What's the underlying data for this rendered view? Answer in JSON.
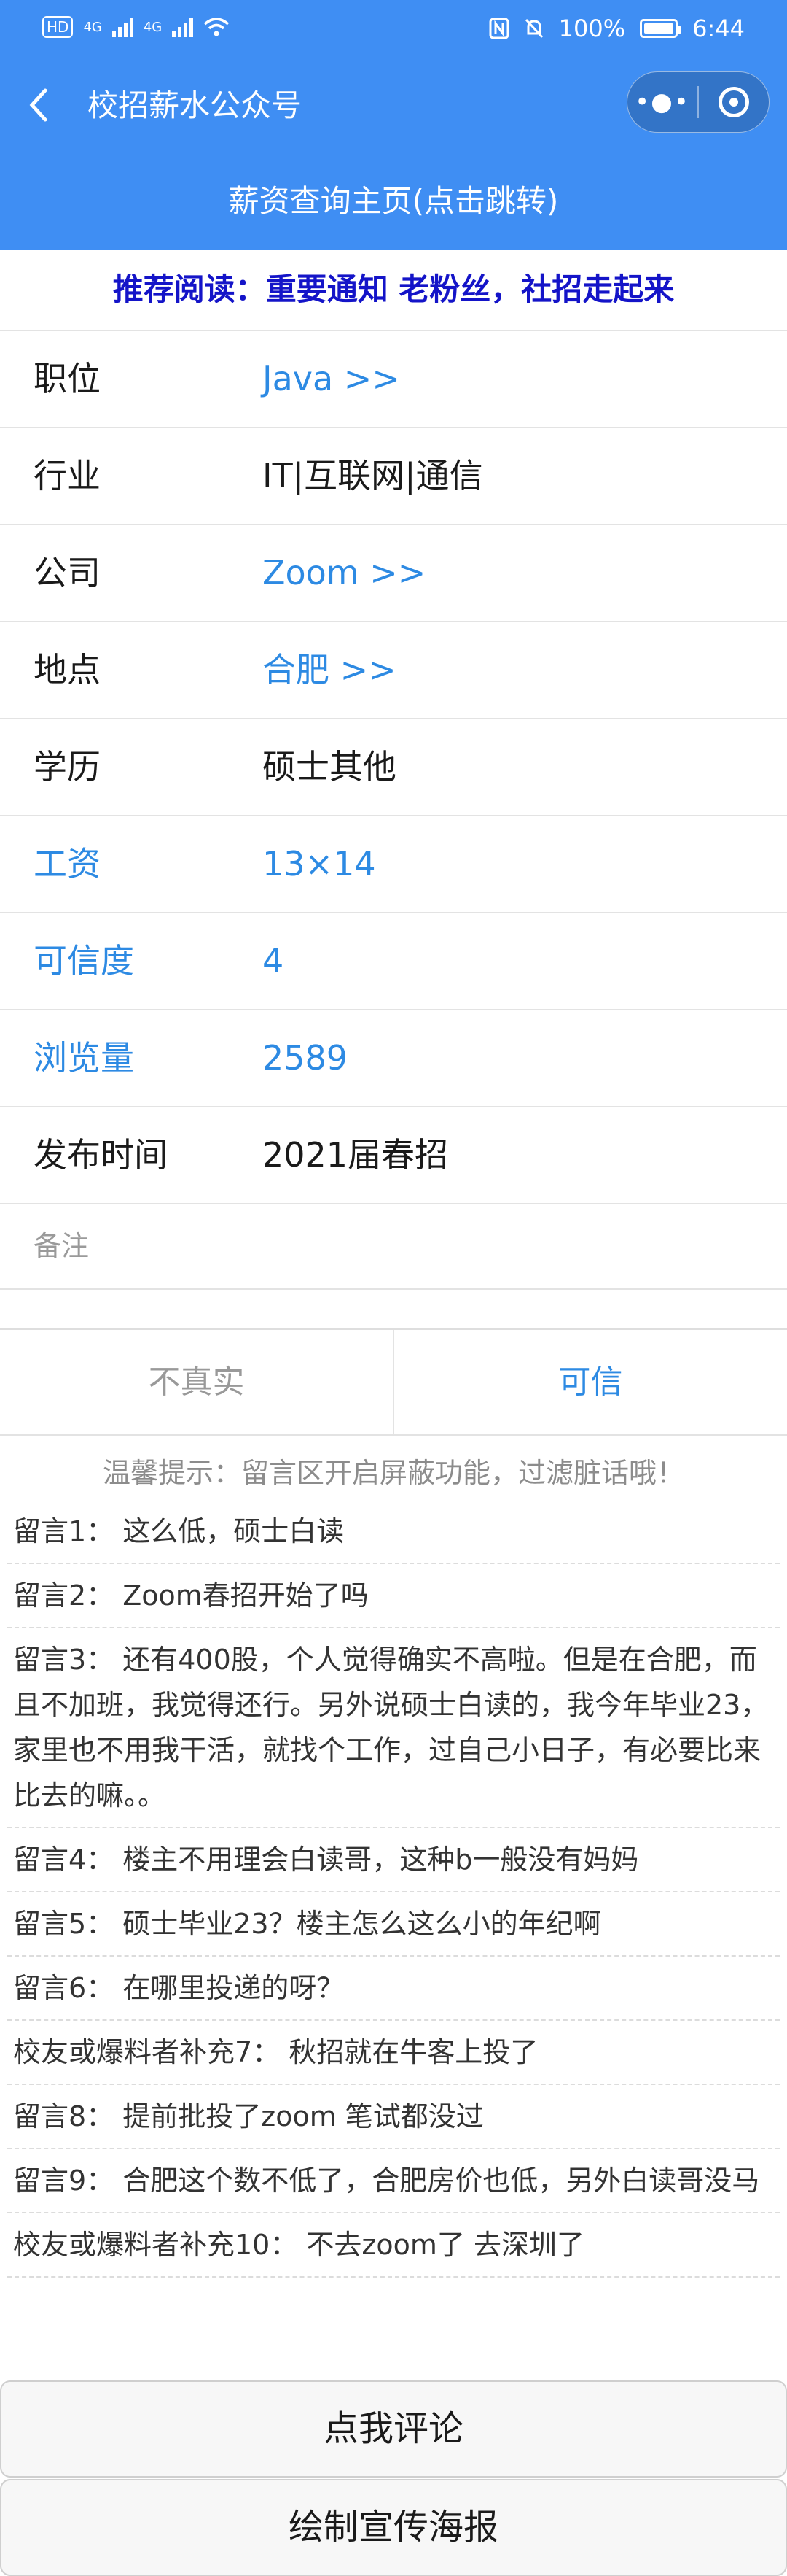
{
  "status_bar": {
    "hd": "HD",
    "network1": "4G",
    "network2": "4G",
    "battery_percent": "100%",
    "battery_level": 1.0,
    "time": "6:44"
  },
  "nav": {
    "title": "校招薪水公众号",
    "back_icon": "chevron-left-icon",
    "more_icon": "more-dots-icon",
    "close_icon": "target-icon"
  },
  "main_link": "薪资查询主页(点击跳转)",
  "banner": "推荐阅读：重要通知 老粉丝，社招走起来",
  "details": [
    {
      "key": "职位",
      "value": "Java >>",
      "key_color": "#1a1a1a",
      "value_color": "#2d8ae3"
    },
    {
      "key": "行业",
      "value": "IT|互联网|通信",
      "key_color": "#1a1a1a",
      "value_color": "#1a1a1a"
    },
    {
      "key": "公司",
      "value": "Zoom >>",
      "key_color": "#1a1a1a",
      "value_color": "#2d8ae3"
    },
    {
      "key": "地点",
      "value": "合肥 >>",
      "key_color": "#1a1a1a",
      "value_color": "#2d8ae3"
    },
    {
      "key": "学历",
      "value": "硕士其他",
      "key_color": "#1a1a1a",
      "value_color": "#1a1a1a"
    },
    {
      "key": "工资",
      "value": "13×14",
      "key_color": "#2d8ae3",
      "value_color": "#2d8ae3"
    },
    {
      "key": "可信度",
      "value": "4",
      "key_color": "#2d8ae3",
      "value_color": "#2d8ae3"
    },
    {
      "key": "浏览量",
      "value": "2589",
      "key_color": "#2d8ae3",
      "value_color": "#2d8ae3"
    },
    {
      "key": "发布时间",
      "value": "2021届春招",
      "key_color": "#1a1a1a",
      "value_color": "#1a1a1a"
    }
  ],
  "remark_label": "备注",
  "votes": {
    "not_real": "不真实",
    "credible": "可信"
  },
  "tip": "温馨提示：留言区开启屏蔽功能，过滤脏话哦！",
  "comments": [
    "留言1： 这么低，硕士白读",
    "留言2： Zoom春招开始了吗",
    "留言3： 还有400股，个人觉得确实不高啦。但是在合肥，而且不加班，我觉得还行。另外说硕士白读的，我今年毕业23，家里也不用我干活，就找个工作，过自己小日子，有必要比来比去的嘛。。",
    "留言4： 楼主不用理会白读哥，这种b一般没有妈妈",
    "留言5： 硕士毕业23？楼主怎么这么小的年纪啊",
    "留言6： 在哪里投递的呀？",
    "校友或爆料者补充7： 秋招就在牛客上投了",
    "留言8： 提前批投了zoom 笔试都没过",
    "留言9： 合肥这个数不低了，合肥房价也低，另外白读哥没马",
    "校友或爆料者补充10： 不去zoom了 去深圳了"
  ],
  "buttons": {
    "comment": "点我评论",
    "poster": "绘制宣传海报"
  }
}
